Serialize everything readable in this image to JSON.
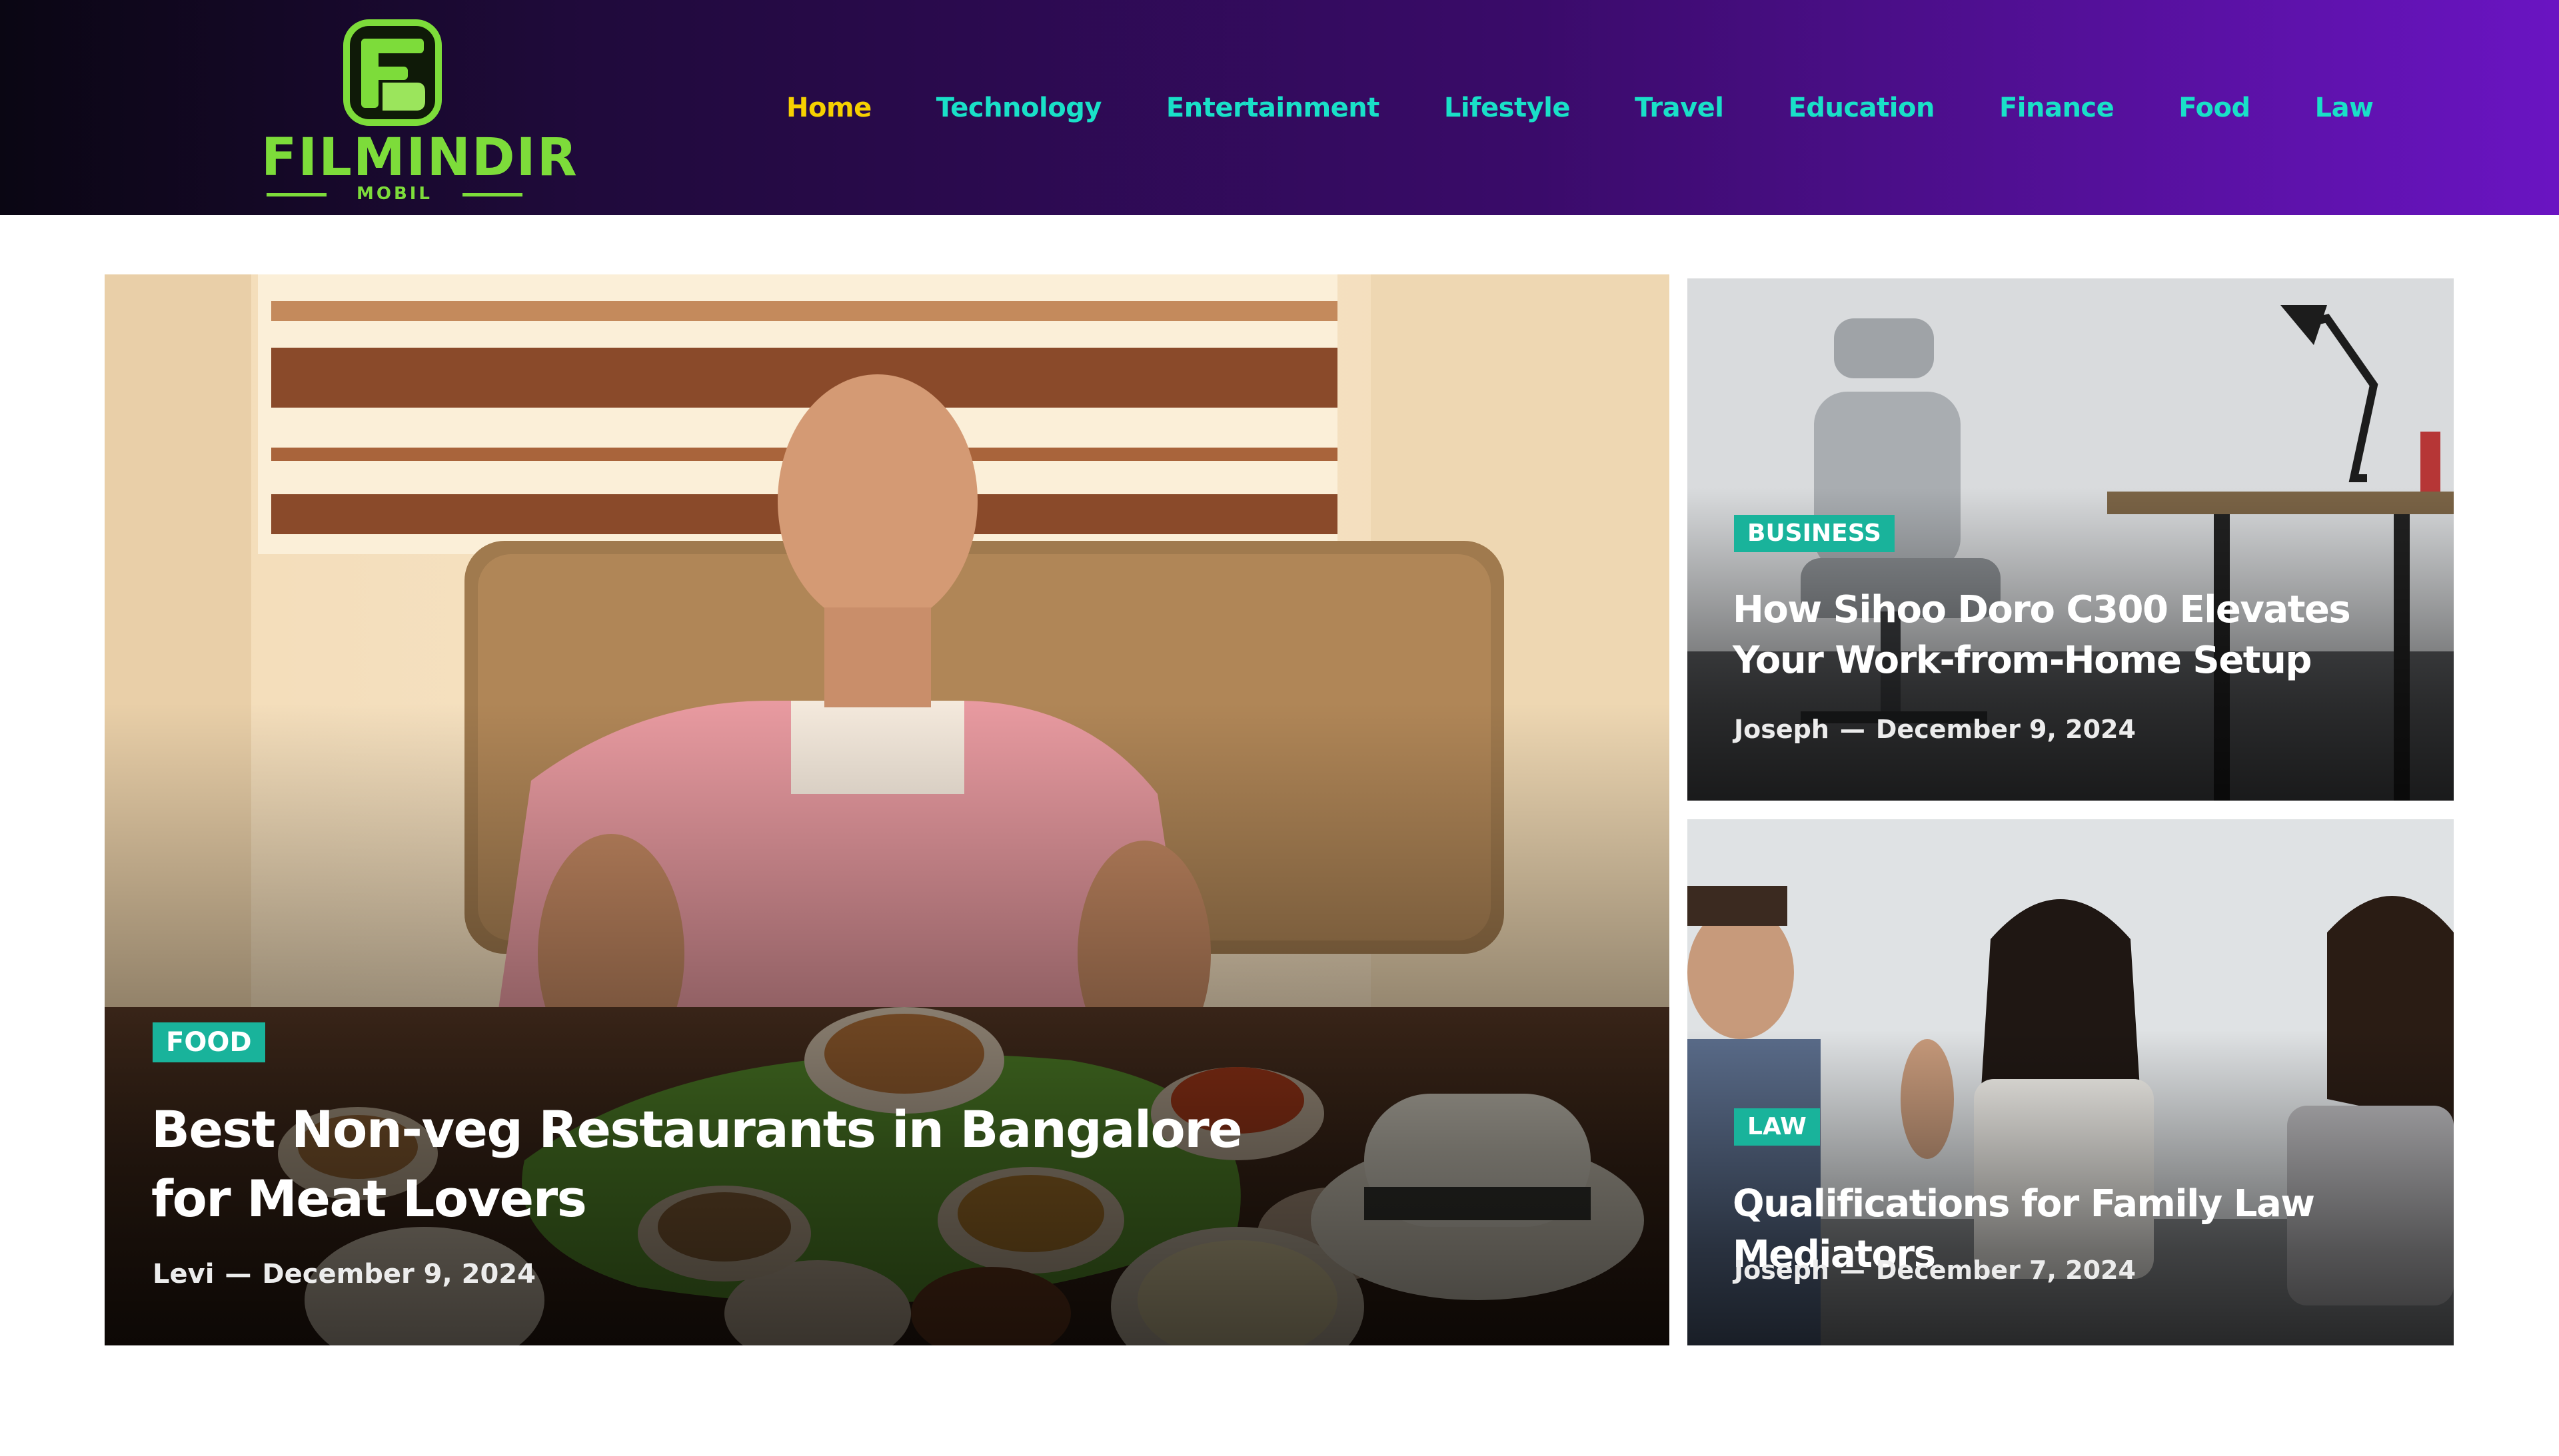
{
  "brand": {
    "name": "FILMINDIR",
    "subtitle": "MOBIL",
    "primary_color": "#7ddc3a"
  },
  "nav": {
    "items": [
      {
        "label": "Home",
        "active": true
      },
      {
        "label": "Technology",
        "active": false
      },
      {
        "label": "Entertainment",
        "active": false
      },
      {
        "label": "Lifestyle",
        "active": false
      },
      {
        "label": "Travel",
        "active": false
      },
      {
        "label": "Education",
        "active": false
      },
      {
        "label": "Finance",
        "active": false
      },
      {
        "label": "Food",
        "active": false
      },
      {
        "label": "Law",
        "active": false
      }
    ],
    "active_color": "#f6d000",
    "link_color": "#19e0c8"
  },
  "featured": {
    "category": "FOOD",
    "title": "Best Non-veg Restaurants in Bangalore for Meat Lovers",
    "author": "Levi",
    "separator": "—",
    "date": "December 9, 2024"
  },
  "side_posts": [
    {
      "category": "BUSINESS",
      "title": "How Sihoo Doro C300 Elevates Your Work-from-Home Setup",
      "author": "Joseph",
      "separator": "—",
      "date": "December 9, 2024"
    },
    {
      "category": "LAW",
      "title": "Qualifications for Family Law Mediators",
      "author": "Joseph",
      "separator": "—",
      "date": "December 7, 2024"
    }
  ],
  "colors": {
    "badge": "#19b39b",
    "header_gradient_start": "#0a0613",
    "header_gradient_end": "#6a14c2"
  }
}
